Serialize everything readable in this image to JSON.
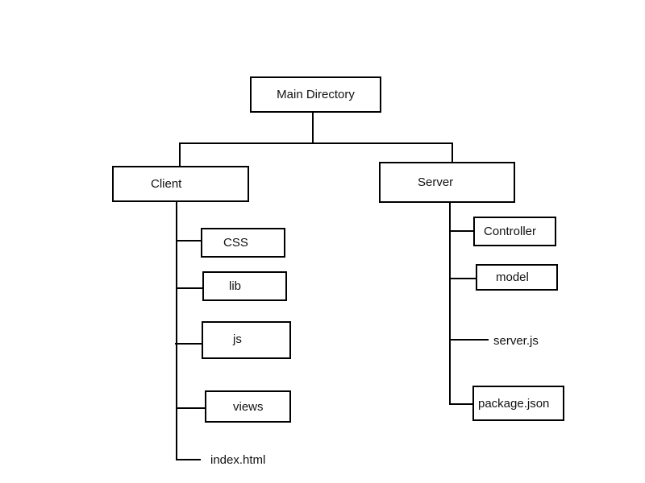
{
  "diagram": {
    "title": "Main Directory",
    "root": {
      "label": "Main Directory"
    },
    "branches": [
      {
        "label": "Client",
        "children": [
          "CSS",
          "lib",
          "js",
          "views",
          "index.html"
        ]
      },
      {
        "label": "Server",
        "children": [
          "Controller",
          "model",
          "server.js",
          "package.json"
        ]
      }
    ]
  }
}
